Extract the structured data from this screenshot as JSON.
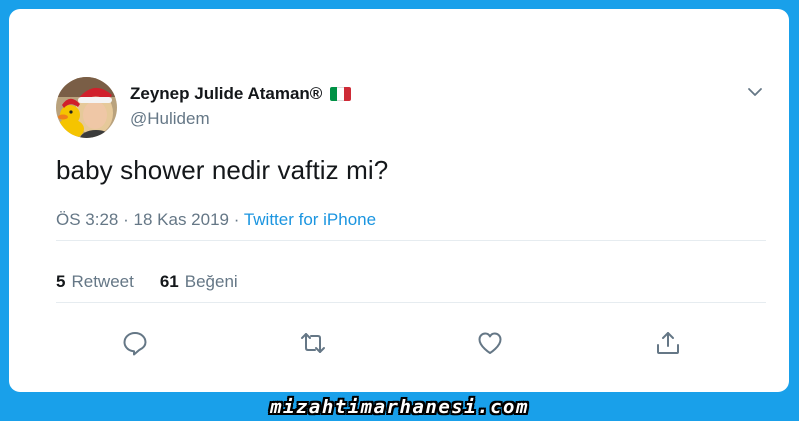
{
  "tweet": {
    "author": {
      "display_name": "Zeynep Julide Ataman®",
      "handle": "@Hulidem",
      "flag": "italy-flag",
      "flag_colors": [
        "#009246",
        "#ffffff",
        "#ce2b37"
      ],
      "avatar": "profile-photo"
    },
    "text": "baby shower nedir vaftiz mi?",
    "meta": {
      "time": "ÖS 3:28",
      "separator": "·",
      "date": "18 Kas 2019",
      "source": "Twitter for iPhone"
    },
    "stats": {
      "retweets_count": "5",
      "retweets_label": "Retweet",
      "likes_count": "61",
      "likes_label": "Beğeni"
    },
    "actions": [
      "reply-icon",
      "retweet-icon",
      "like-icon",
      "share-icon"
    ],
    "menu_icon": "chevron-down-icon"
  },
  "colors": {
    "background": "#19a0ea",
    "card": "#ffffff",
    "primary_text": "#14171a",
    "secondary_text": "#657786",
    "link": "#1b95e0",
    "divider": "#e6ecf0"
  },
  "watermark": "mizahtimarhanesi.com"
}
